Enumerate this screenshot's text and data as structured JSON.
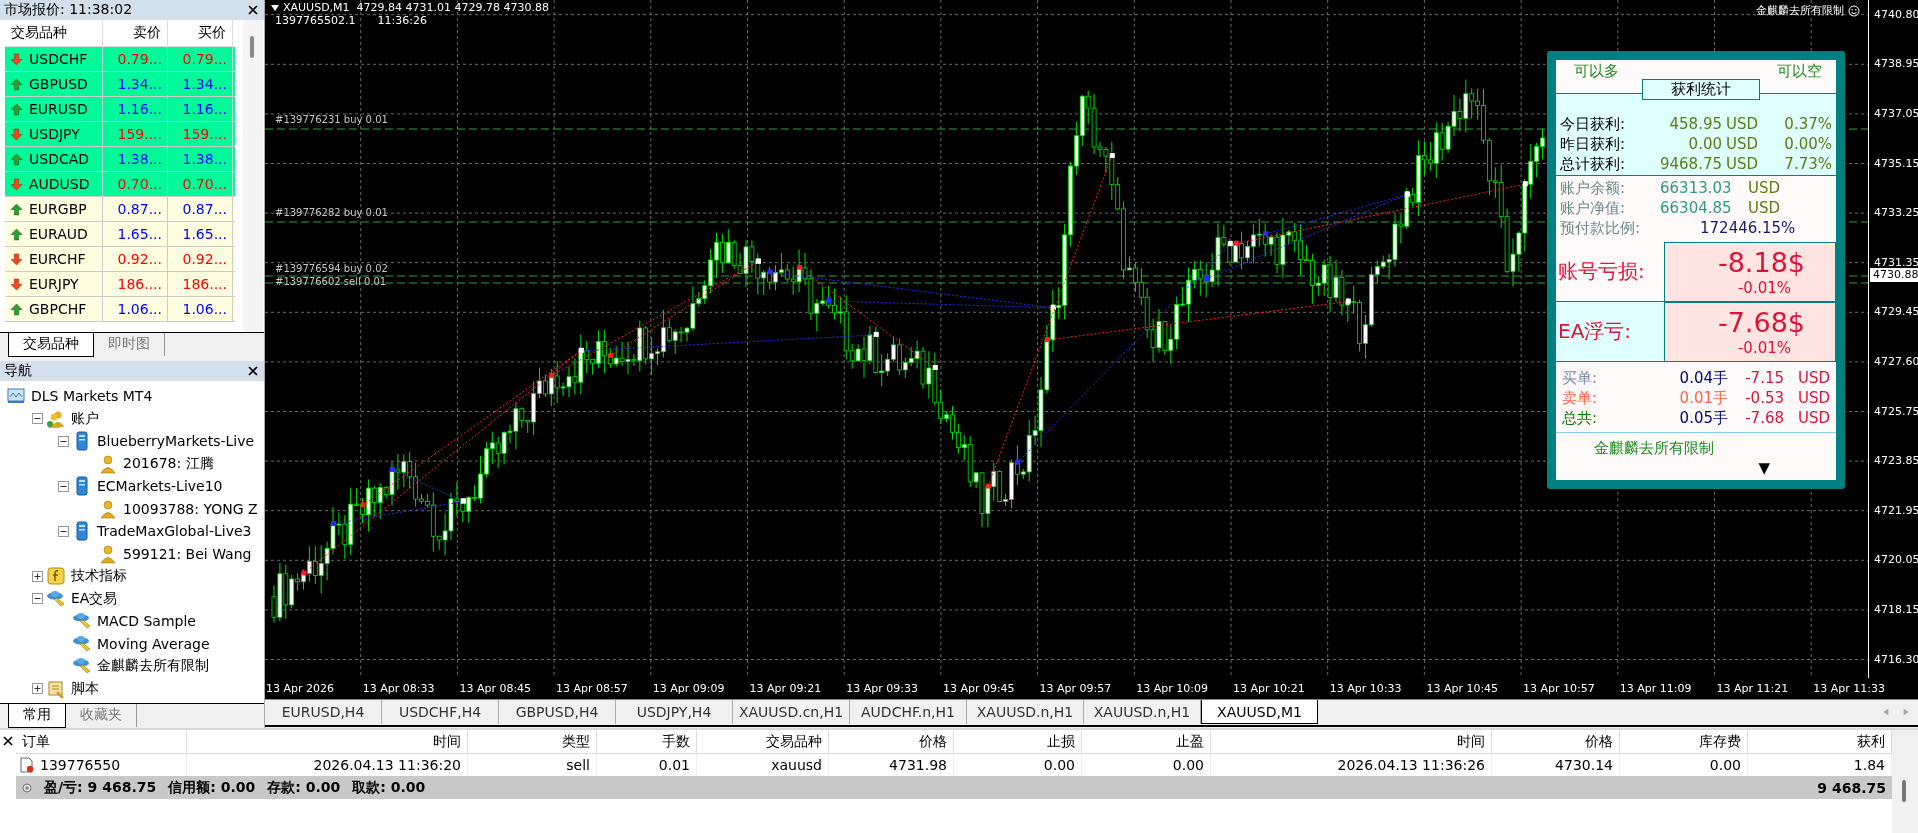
{
  "market_watch": {
    "title": "市场报价: 11:38:02",
    "columns": [
      "交易品种",
      "卖价",
      "买价"
    ],
    "rows": [
      {
        "symbol": "USDCHF",
        "rising": false,
        "bid": "0.79...",
        "ask": "0.79...",
        "highlighted": true
      },
      {
        "symbol": "GBPUSD",
        "rising": true,
        "bid": "1.34...",
        "ask": "1.34...",
        "highlighted": true
      },
      {
        "symbol": "EURUSD",
        "rising": true,
        "bid": "1.16...",
        "ask": "1.16...",
        "highlighted": true
      },
      {
        "symbol": "USDJPY",
        "rising": false,
        "bid": "159....",
        "ask": "159....",
        "highlighted": true
      },
      {
        "symbol": "USDCAD",
        "rising": true,
        "bid": "1.38...",
        "ask": "1.38...",
        "highlighted": true
      },
      {
        "symbol": "AUDUSD",
        "rising": false,
        "bid": "0.70...",
        "ask": "0.70...",
        "highlighted": true
      },
      {
        "symbol": "EURGBP",
        "rising": true,
        "bid": "0.87...",
        "ask": "0.87...",
        "highlighted": false
      },
      {
        "symbol": "EURAUD",
        "rising": true,
        "bid": "1.65...",
        "ask": "1.65...",
        "highlighted": false
      },
      {
        "symbol": "EURCHF",
        "rising": false,
        "bid": "0.92...",
        "ask": "0.92...",
        "highlighted": false
      },
      {
        "symbol": "EURJPY",
        "rising": false,
        "bid": "186....",
        "ask": "186....",
        "highlighted": false
      },
      {
        "symbol": "GBPCHF",
        "rising": true,
        "bid": "1.06...",
        "ask": "1.06...",
        "highlighted": false
      }
    ],
    "tabs": [
      {
        "label": "交易品种",
        "selected": true
      },
      {
        "label": "即时图",
        "selected": false
      }
    ]
  },
  "navigator": {
    "title": "导航",
    "tree": [
      {
        "label": "DLS Markets MT4",
        "kind": "terminal",
        "children": [
          {
            "label": "账户",
            "kind": "accounts",
            "expanded": true,
            "children": [
              {
                "label": "BlueberryMarkets-Live",
                "kind": "server",
                "expanded": true,
                "children": [
                  {
                    "label": "201678: 江腾",
                    "kind": "user"
                  }
                ]
              },
              {
                "label": "ECMarkets-Live10",
                "kind": "server",
                "expanded": true,
                "children": [
                  {
                    "label": "10093788: YONG Z",
                    "kind": "user"
                  }
                ]
              },
              {
                "label": "TradeMaxGlobal-Live3",
                "kind": "server",
                "expanded": true,
                "children": [
                  {
                    "label": "599121: Bei Wang",
                    "kind": "user"
                  }
                ]
              }
            ]
          },
          {
            "label": "技术指标",
            "kind": "indicators",
            "expanded": false
          },
          {
            "label": "EA交易",
            "kind": "experts",
            "expanded": true,
            "children": [
              {
                "label": "MACD Sample",
                "kind": "expert"
              },
              {
                "label": "Moving Average",
                "kind": "expert"
              },
              {
                "label": "金麒麟去所有限制",
                "kind": "expert"
              }
            ]
          },
          {
            "label": "脚本",
            "kind": "scripts",
            "expanded": false
          }
        ]
      }
    ],
    "tabs": [
      {
        "label": "常用",
        "selected": true
      },
      {
        "label": "收藏夹",
        "selected": false
      }
    ]
  },
  "chart": {
    "header": "XAUUSD,M1  4729.84 4731.01 4729.78 4730.88",
    "info": [
      "1397765502.1",
      "11:36:26"
    ],
    "corner_label": "金麒麟去所有限制",
    "price_ticks": [
      "4740.80",
      "4738.95",
      "4737.05",
      "4735.15",
      "4733.25",
      "4731.35",
      "4729.45",
      "4727.60",
      "4725.75",
      "4723.85",
      "4721.95",
      "4720.05",
      "4718.15",
      "4716.30"
    ],
    "current_price": "4730.88",
    "time_labels": [
      "13 Apr 2026",
      "13 Apr 08:33",
      "13 Apr 08:45",
      "13 Apr 08:57",
      "13 Apr 09:09",
      "13 Apr 09:21",
      "13 Apr 09:33",
      "13 Apr 09:45",
      "13 Apr 09:57",
      "13 Apr 10:09",
      "13 Apr 10:21",
      "13 Apr 10:33",
      "13 Apr 10:45",
      "13 Apr 10:57",
      "13 Apr 11:09",
      "13 Apr 11:21",
      "13 Apr 11:33"
    ],
    "orders": [
      {
        "label": "#139776231 buy 0.01"
      },
      {
        "label": "#139776282 buy 0.01"
      },
      {
        "label": "#139776594 buy 0.02"
      },
      {
        "label": "#139776602 sell 0.01"
      }
    ],
    "panel": {
      "left_tag": "可以多",
      "title": "获利统计",
      "right_tag": "可以空",
      "profit_rows": [
        {
          "label": "今日获利:",
          "amount": "458.95",
          "currency": "USD",
          "percent": "0.37%"
        },
        {
          "label": "昨日获利:",
          "amount": "0.00",
          "currency": "USD",
          "percent": "0.00%"
        },
        {
          "label": "总计获利:",
          "amount": "9468.75",
          "currency": "USD",
          "percent": "7.73%"
        }
      ],
      "account_rows": [
        {
          "label": "账户余额:",
          "value": "66313.03",
          "currency": "USD"
        },
        {
          "label": "账户净值:",
          "value": "66304.85",
          "currency": "USD"
        },
        {
          "label": "预付款比例:",
          "value": "172446.15%"
        }
      ],
      "loss_rows": [
        {
          "kind": "account",
          "label": "账号亏损:",
          "amount": "-8.18$",
          "percent": "-0.01%"
        },
        {
          "kind": "ea",
          "label": "EA浮亏:",
          "amount": "-7.68$",
          "percent": "-0.01%"
        }
      ],
      "orders": [
        {
          "kind": "buy",
          "label": "买单:",
          "lots": "0.04手",
          "profit": "-7.15",
          "currency": "USD"
        },
        {
          "kind": "sell",
          "label": "卖单:",
          "lots": "0.01手",
          "profit": "-0.53",
          "currency": "USD"
        },
        {
          "kind": "total",
          "label": "总共:",
          "lots": "0.05手",
          "profit": "-7.68",
          "currency": "USD"
        }
      ],
      "footer": "金麒麟去所有限制",
      "footer_mark": "▼"
    }
  },
  "chart_tabs": [
    {
      "label": "EURUSD,H4",
      "selected": false
    },
    {
      "label": "USDCHF,H4",
      "selected": false
    },
    {
      "label": "GBPUSD,H4",
      "selected": false
    },
    {
      "label": "USDJPY,H4",
      "selected": false
    },
    {
      "label": "XAUUSD.cn,H1",
      "selected": false
    },
    {
      "label": "AUDCHF.n,H1",
      "selected": false
    },
    {
      "label": "XAUUSD.n,H1",
      "selected": false
    },
    {
      "label": "XAUUSD.n,H1",
      "selected": false
    },
    {
      "label": "XAUUSD,M1",
      "selected": true
    }
  ],
  "terminal": {
    "columns": [
      "订单",
      "时间",
      "类型",
      "手数",
      "交易品种",
      "价格",
      "止损",
      "止盈",
      "时间",
      "价格",
      "库存费",
      "获利"
    ],
    "rows": [
      {
        "cells": [
          "139776550",
          "2026.04.13 11:36:20",
          "sell",
          "0.01",
          "xauusd",
          "4731.98",
          "0.00",
          "0.00",
          "2026.04.13 11:36:26",
          "4730.14",
          "0.00",
          "1.84"
        ]
      }
    ],
    "summary": [
      "盈/亏: 9 468.75",
      "信用额: 0.00",
      "存款: 0.00",
      "取款: 0.00"
    ],
    "summary_total": "9 468.75"
  }
}
